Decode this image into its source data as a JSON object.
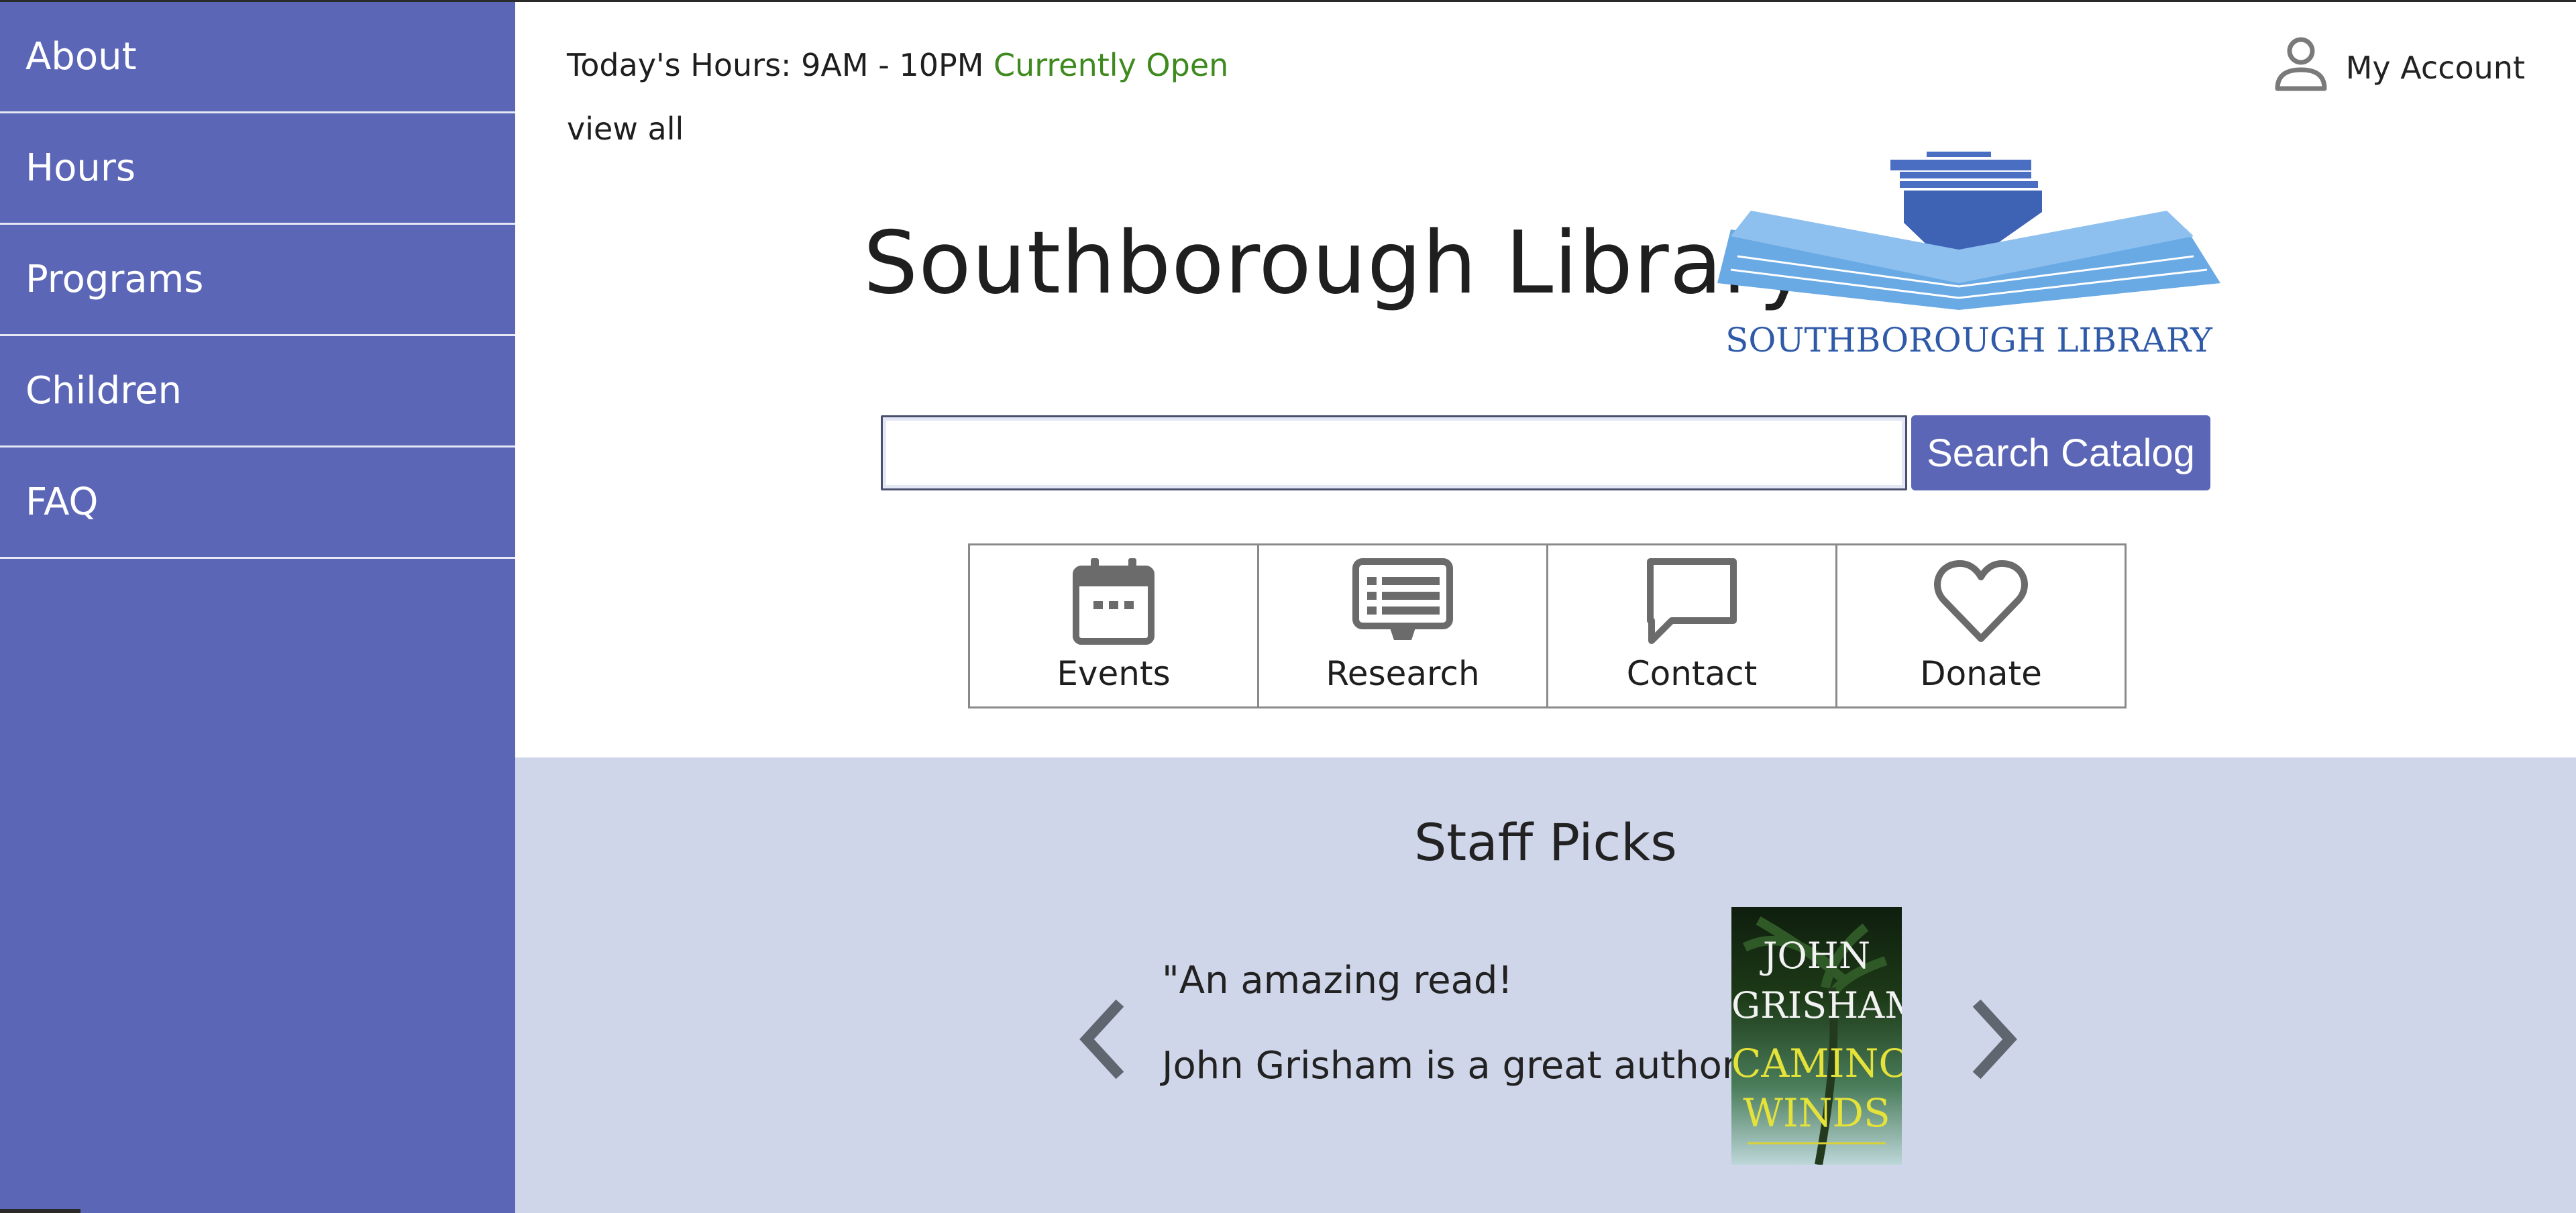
{
  "sidebar": {
    "items": [
      {
        "label": "About"
      },
      {
        "label": "Hours"
      },
      {
        "label": "Programs"
      },
      {
        "label": "Children"
      },
      {
        "label": "FAQ"
      }
    ]
  },
  "header": {
    "hours_prefix": "Today's Hours: 9AM - 10PM",
    "status": "Currently Open",
    "view_all": "view all",
    "account": "My Account"
  },
  "site": {
    "title": "Southborough Library",
    "logo_text": "SOUTHBOROUGH LIBRARY"
  },
  "search": {
    "value": "",
    "placeholder": "",
    "button": "Search Catalog"
  },
  "tiles": [
    {
      "label": "Events",
      "icon": "calendar-icon"
    },
    {
      "label": "Research",
      "icon": "monitor-icon"
    },
    {
      "label": "Contact",
      "icon": "speech-bubble-icon"
    },
    {
      "label": "Donate",
      "icon": "heart-icon"
    }
  ],
  "staff_picks": {
    "title": "Staff Picks",
    "quote_line1": "\"An amazing read!",
    "quote_line2": "John Grisham is a great author.\"",
    "cover": {
      "author": "JOHN GRISHAM",
      "author_line1": "JOHN",
      "author_line2": "GRISHAM",
      "title_line1": "CAMINO",
      "title_line2": "WINDS"
    }
  },
  "colors": {
    "sidebar": "#5b66b7",
    "open_status": "#3f8a1e",
    "picks_bg": "#cfd6ea"
  }
}
